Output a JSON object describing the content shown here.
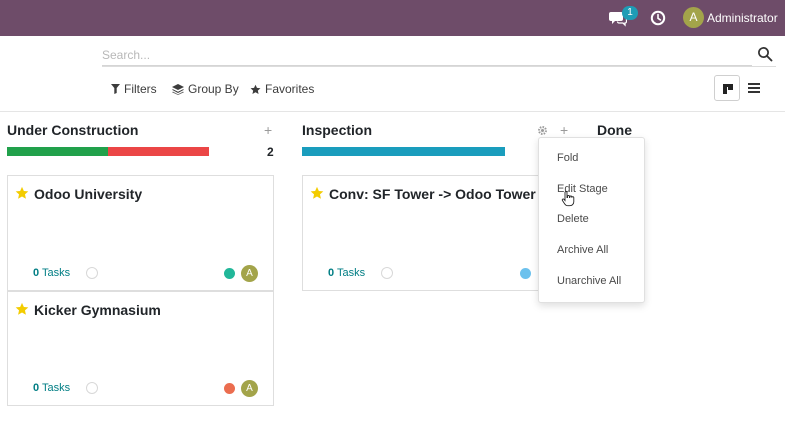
{
  "navbar": {
    "messages_count": "1",
    "user_initial": "A",
    "user_name": "Administrator",
    "bg_color": "#6e4c69"
  },
  "search": {
    "placeholder": "Search...",
    "value": ""
  },
  "filters": {
    "filters_label": "Filters",
    "group_by_label": "Group By",
    "favorites_label": "Favorites"
  },
  "view_switcher": {
    "active": "kanban",
    "icons": [
      "kanban-icon",
      "list-icon"
    ]
  },
  "columns": [
    {
      "title": "Under Construction",
      "count": "2",
      "progress_colors": [
        "#21a14b",
        "#eb4646"
      ],
      "progress_values": [
        0.5,
        0.5
      ],
      "cards": [
        {
          "title": "Odoo University",
          "tasks_count": "0",
          "tasks_label": "Tasks",
          "status_color": "#21b799",
          "avatar_initial": "A"
        },
        {
          "title": "Kicker Gymnasium",
          "tasks_count": "0",
          "tasks_label": "Tasks",
          "status_color": "#eb6d4f",
          "avatar_initial": "A"
        }
      ]
    },
    {
      "title": "Inspection",
      "progress_colors": [
        "#1a9dbd"
      ],
      "progress_values": [
        1.0
      ],
      "cards": [
        {
          "title": "Conv: SF Tower -> Odoo Tower",
          "tasks_count": "0",
          "tasks_label": "Tasks",
          "status_color": "#6cc1ed"
        }
      ]
    },
    {
      "title": "Done"
    }
  ],
  "column_menu": {
    "items": [
      "Fold",
      "Edit Stage",
      "Delete",
      "Archive All",
      "Unarchive All"
    ],
    "hovered": "Edit Stage"
  }
}
